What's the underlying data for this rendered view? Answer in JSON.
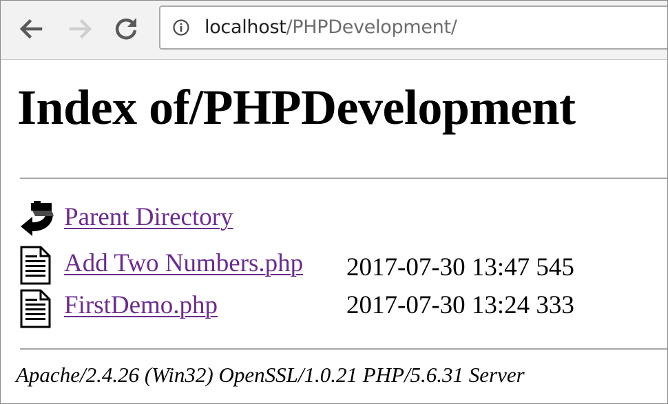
{
  "browser": {
    "back_icon": "arrow-left-icon",
    "forward_icon": "arrow-right-icon",
    "reload_icon": "reload-icon",
    "info_icon": "info-circle-icon",
    "url_host": "localhost",
    "url_path": "/PHPDevelopment/"
  },
  "page": {
    "title": "Index of/PHPDevelopment",
    "parent": {
      "icon": "back-arrow-folder-icon",
      "label": "Parent Directory"
    },
    "files": [
      {
        "icon": "text-file-icon",
        "name": "Add Two Numbers.php",
        "meta": "2017-07-30 13:47 545"
      },
      {
        "icon": "text-file-icon",
        "name": "FirstDemo.php",
        "meta": "2017-07-30 13:24 333"
      }
    ],
    "server_signature": "Apache/2.4.26 (Win32) OpenSSL/1.0.21 PHP/5.6.31 Server"
  },
  "colors": {
    "link_visited": "#6b2c8f",
    "toolbar_bg": "#f2f2f2",
    "rule": "#a8a8a8"
  }
}
